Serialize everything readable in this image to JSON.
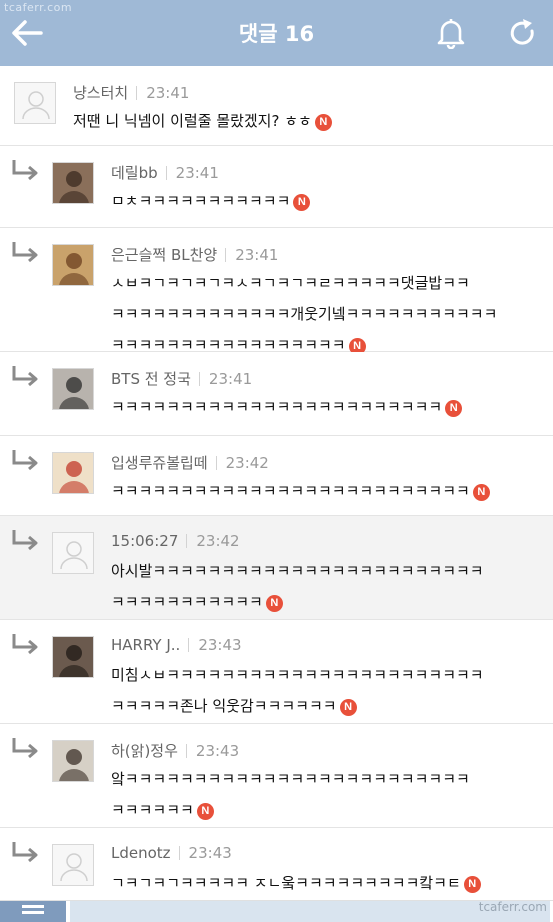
{
  "watermark": "tcaferr.com",
  "header": {
    "title": "댓글 16",
    "back_icon": "arrow-left-icon",
    "bell_icon": "bell-icon",
    "refresh_icon": "refresh-icon"
  },
  "comments": [
    {
      "nick": "냥스터치",
      "time": "23:41",
      "lines": [
        "저땐 니 닉넴이 이럴줄 몰랐겠지? ㅎㅎ"
      ],
      "new": "N"
    },
    {
      "nick": "데릴bb",
      "time": "23:41",
      "lines": [
        "ㅁㅊㅋㅋㅋㅋㅋㅋㅋㅋㅋㅋㅋ"
      ],
      "new": "N"
    },
    {
      "nick": "은근슬쩍 BL찬양",
      "time": "23:41",
      "lines": [
        "ㅅㅂㅋㄱㅋㄱㅋㄱㅋㅅㅋㄱㅋㄱㅋㄹㅋㅋㅋㅋㅋ댓글밥ㅋㅋ",
        "ㅋㅋㅋㅋㅋㅋㅋㅋㅋㅋㅋㅋㅋ개웃기넼ㅋㅋㅋㅋㅋㅋㅋㅋㅋㅋㅋ",
        "ㅋㅋㅋㅋㅋㅋㅋㅋㅋㅋㅋㅋㅋㅋㅋㅋㅋ"
      ],
      "new": "N"
    },
    {
      "nick": "BTS 전 정국",
      "time": "23:41",
      "lines": [
        "ㅋㅋㅋㅋㅋㅋㅋㅋㅋㅋㅋㅋㅋㅋㅋㅋㅋㅋㅋㅋㅋㅋㅋㅋ"
      ],
      "new": "N"
    },
    {
      "nick": "입생루쥬볼립떼",
      "time": "23:42",
      "lines": [
        "ㅋㅋㅋㅋㅋㅋㅋㅋㅋㅋㅋㅋㅋㅋㅋㅋㅋㅋㅋㅋㅋㅋㅋㅋㅋㅋ"
      ],
      "new": "N"
    },
    {
      "nick": "15:06:27",
      "time": "23:42",
      "lines": [
        "아시발ㅋㅋㅋㅋㅋㅋㅋㅋㅋㅋㅋㅋㅋㅋㅋㅋㅋㅋㅋㅋㅋㅋㅋㅋ",
        "ㅋㅋㅋㅋㅋㅋㅋㅋㅋㅋㅋ"
      ],
      "new": "N"
    },
    {
      "nick": "HARRY J..",
      "time": "23:43",
      "lines": [
        "미침ㅅㅂㅋㅋㅋㅋㅋㅋㅋㅋㅋㅋㅋㅋㅋㅋㅋㅋㅋㅋㅋㅋㅋㅋㅋ",
        "ㅋㅋㅋㅋㅋ존나 익웃감ㅋㅋㅋㅋㅋㅋ"
      ],
      "new": "N"
    },
    {
      "nick": "하(앍)정우",
      "time": "23:43",
      "lines": [
        "앜ㅋㅋㅋㅋㅋㅋㅋㅋㅋㅋㅋㅋㅋㅋㅋㅋㅋㅋㅋㅋㅋㅋㅋㅋㅋ",
        "ㅋㅋㅋㅋㅋㅋ"
      ],
      "new": "N"
    },
    {
      "nick": "Ldenotz",
      "time": "23:43",
      "lines": [
        "ㄱㅋㄱㅋㄱㅋㅋㅋㅋㅋ ㅈㄴ웈ㅋㅋㅋㅋㅋㅋㅋㅋㅋ캌ㅋㅌ"
      ],
      "new": "N"
    }
  ]
}
